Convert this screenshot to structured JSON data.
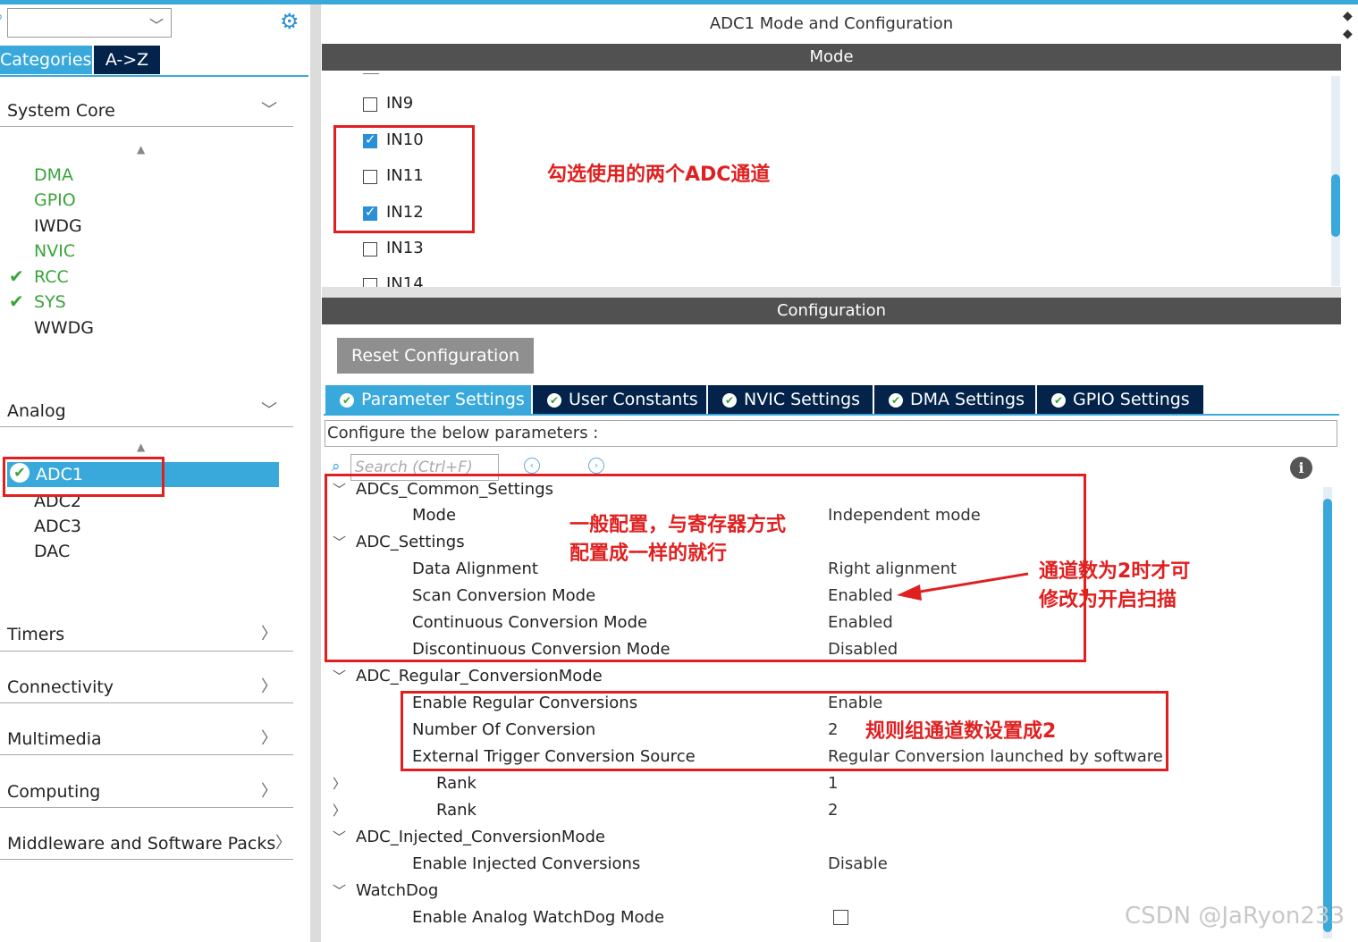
{
  "window_title": "ADC1 Mode and Configuration",
  "left": {
    "tabs": {
      "categories": "Categories",
      "az": "A->Z"
    },
    "system_core": {
      "label": "System Core",
      "items": [
        "DMA",
        "GPIO",
        "IWDG",
        "NVIC",
        "RCC",
        "SYS",
        "WWDG"
      ]
    },
    "analog": {
      "label": "Analog",
      "items": [
        "ADC1",
        "ADC2",
        "ADC3",
        "DAC"
      ]
    },
    "categories": [
      "Timers",
      "Connectivity",
      "Multimedia",
      "Computing",
      "Middleware and Software Packs"
    ]
  },
  "mode": {
    "header": "Mode",
    "channels": [
      {
        "label": "IN9",
        "checked": false
      },
      {
        "label": "IN10",
        "checked": true
      },
      {
        "label": "IN11",
        "checked": false
      },
      {
        "label": "IN12",
        "checked": true
      },
      {
        "label": "IN13",
        "checked": false
      },
      {
        "label": "IN14",
        "checked": false
      }
    ]
  },
  "configuration": {
    "header": "Configuration",
    "reset_label": "Reset Configuration",
    "tabs": [
      "Parameter Settings",
      "User Constants",
      "NVIC Settings",
      "DMA Settings",
      "GPIO Settings"
    ],
    "configure_text": "Configure the below parameters :",
    "search_placeholder": "Search (Ctrl+F)",
    "rows": [
      {
        "group": "ADCs_Common_Settings"
      },
      {
        "name": "Mode",
        "value": "Independent mode"
      },
      {
        "group": "ADC_Settings"
      },
      {
        "name": "Data Alignment",
        "value": "Right alignment"
      },
      {
        "name": "Scan Conversion Mode",
        "value": "Enabled"
      },
      {
        "name": "Continuous Conversion Mode",
        "value": "Enabled"
      },
      {
        "name": "Discontinuous Conversion Mode",
        "value": "Disabled"
      },
      {
        "group": "ADC_Regular_ConversionMode"
      },
      {
        "name": "Enable Regular Conversions",
        "value": "Enable"
      },
      {
        "name": "Number Of Conversion",
        "value": "2"
      },
      {
        "name": "External Trigger Conversion Source",
        "value": "Regular Conversion launched by software"
      },
      {
        "name": "Rank",
        "value": "1"
      },
      {
        "name": "Rank",
        "value": "2"
      },
      {
        "group": "ADC_Injected_ConversionMode"
      },
      {
        "name": "Enable Injected Conversions",
        "value": "Disable"
      },
      {
        "group": "WatchDog"
      },
      {
        "name": "Enable Analog WatchDog Mode",
        "value": ""
      }
    ]
  },
  "annotations": {
    "channels_note": "勾选使用的两个ADC通道",
    "common_note_1": "一般配置，与寄存器方式",
    "common_note_2": "配置成一样的就行",
    "scan_note_1": "通道数为2时才可",
    "scan_note_2": "修改为开启扫描",
    "regular_note": "规则组通道数设置成2"
  },
  "watermark": "CSDN @JaRyon233",
  "colors": {
    "accent": "#39a9dc",
    "navy": "#03234b",
    "bar": "#515151",
    "annotation": "#e02020",
    "ok": "#3aa43a"
  }
}
